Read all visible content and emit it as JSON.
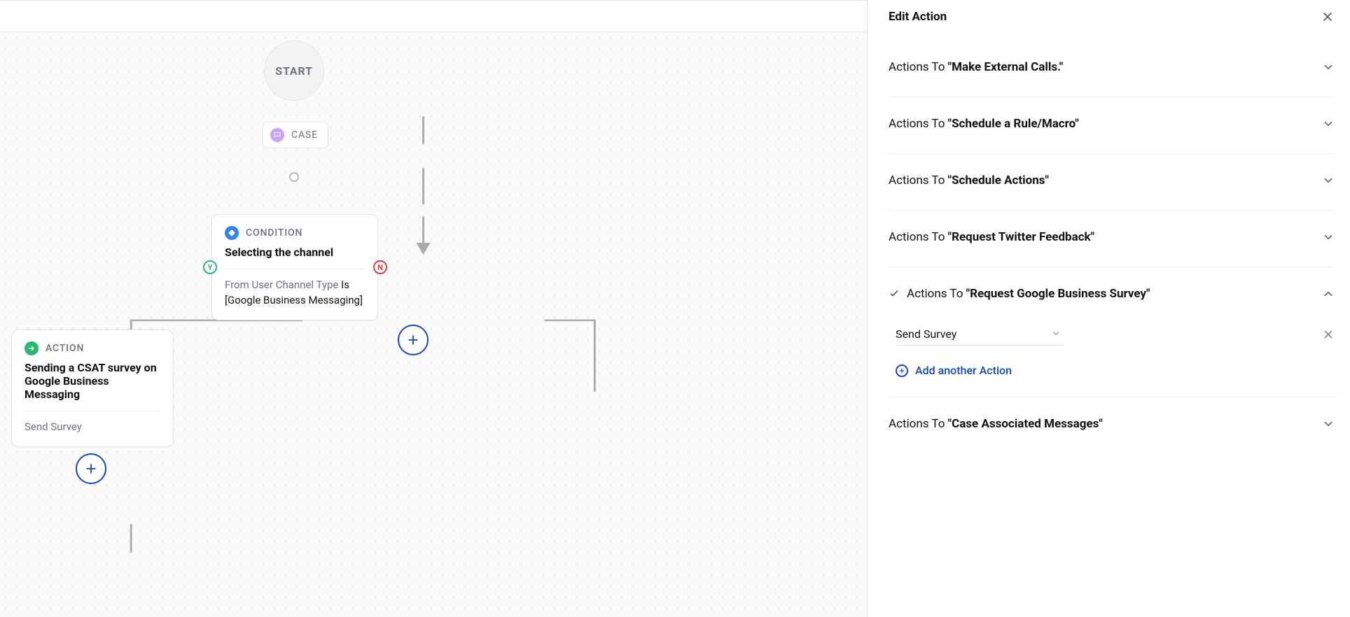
{
  "panel": {
    "title": "Edit Action",
    "actions_prefix": "Actions To ",
    "items": [
      {
        "name": "\"Make External Calls.\"",
        "expanded": false,
        "checked": false
      },
      {
        "name": "\"Schedule a Rule/Macro\"",
        "expanded": false,
        "checked": false
      },
      {
        "name": "\"Schedule Actions\"",
        "expanded": false,
        "checked": false
      },
      {
        "name": "\"Request Twitter Feedback\"",
        "expanded": false,
        "checked": false
      },
      {
        "name": "\"Request Google Business Survey\"",
        "expanded": true,
        "checked": true
      },
      {
        "name": "\"Case Associated Messages\"",
        "expanded": false,
        "checked": false
      }
    ],
    "selected_action": "Send Survey",
    "add_another_label": "Add another Action"
  },
  "flow": {
    "start_label": "START",
    "case_chip_label": "CASE",
    "condition": {
      "tag": "CONDITION",
      "title": "Selecting the channel",
      "field_label": "From User Channel Type",
      "op_label": "Is",
      "value_label": "[Google Business Messaging]"
    },
    "action": {
      "tag": "ACTION",
      "title": "Sending a CSAT survey on Google Business Messaging",
      "body": "Send Survey"
    },
    "branches": {
      "yes": "Y",
      "no": "N"
    }
  }
}
